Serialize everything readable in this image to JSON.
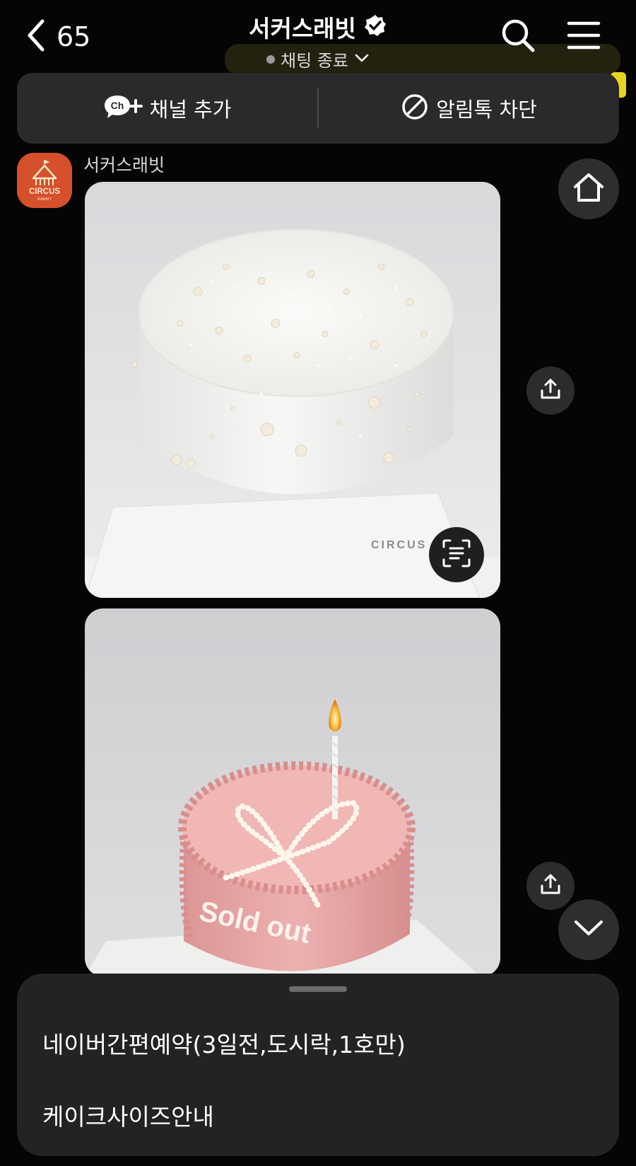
{
  "header": {
    "back_count": "65",
    "title": "서커스래빗",
    "status": "채팅 종료",
    "verified": true
  },
  "channel_bar": {
    "add_channel_label": "채널 추가",
    "add_channel_badge": "Ch",
    "block_label": "알림톡 차단"
  },
  "message": {
    "sender": "서커스래빗",
    "avatar_text": "CIRCUS",
    "avatar_subtext": "RABBIT"
  },
  "photos": {
    "photo1_watermark": "CIRCUS",
    "photo2_text": "Sold out"
  },
  "bottom_sheet": {
    "items": [
      {
        "label": "네이버간편예약(3일전,도시락,1호만)"
      },
      {
        "label": "케이크사이즈안내"
      }
    ]
  },
  "colors": {
    "background": "#050505",
    "panel": "#2a2a2c",
    "sheet": "#232325",
    "avatar": "#d6502b",
    "pink_cake": "#e9a7a7"
  },
  "icons": [
    "chevron-left-icon",
    "verified-badge-icon",
    "chevron-down-icon",
    "search-icon",
    "menu-icon",
    "channel-add-icon",
    "block-icon",
    "home-icon",
    "share-icon",
    "scan-text-icon"
  ]
}
